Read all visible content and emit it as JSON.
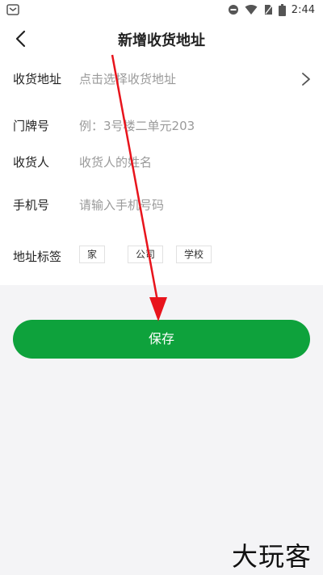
{
  "status_bar": {
    "time": "2:44",
    "icons": [
      "dnd-icon",
      "wifi-icon",
      "no-sim-icon",
      "battery-icon"
    ]
  },
  "nav": {
    "title": "新增收货地址",
    "back_icon": "chevron-left-icon"
  },
  "form": {
    "address": {
      "label": "收货地址",
      "placeholder": "点击选择收货地址"
    },
    "door_number": {
      "label": "门牌号",
      "placeholder": "例：3号楼二单元203"
    },
    "recipient": {
      "label": "收货人",
      "placeholder": "收货人的姓名"
    },
    "phone": {
      "label": "手机号",
      "placeholder": "请输入手机号码"
    },
    "tags": {
      "label": "地址标签",
      "options": [
        "家",
        "公司",
        "学校"
      ]
    }
  },
  "save_button": {
    "label": "保存",
    "color": "#0ea23c"
  },
  "watermark": "大玩客",
  "colors": {
    "arrow": "#e8141c",
    "background": "#f4f4f6"
  }
}
